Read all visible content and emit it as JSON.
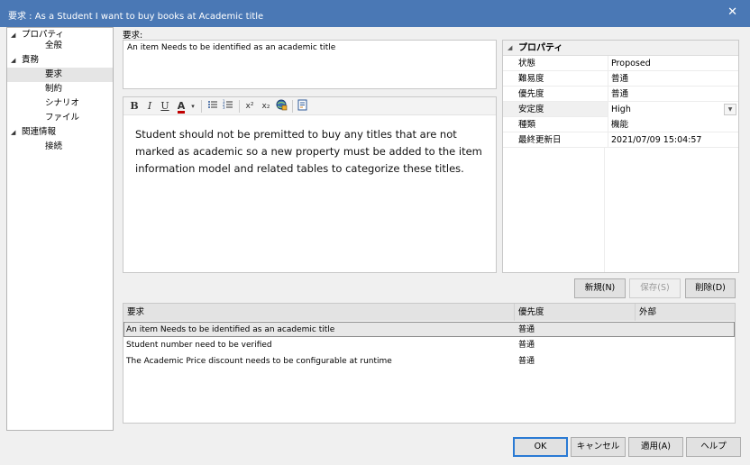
{
  "window": {
    "title": "要求 : As a Student I want to buy books at Academic title",
    "close_glyph": "✕"
  },
  "tree": {
    "items": [
      {
        "label": "プロパティ",
        "level": 0,
        "expanded": true
      },
      {
        "label": "全般",
        "level": 1
      },
      {
        "label": "責務",
        "level": 0,
        "expanded": true
      },
      {
        "label": "要求",
        "level": 1,
        "selected": true
      },
      {
        "label": "制約",
        "level": 1
      },
      {
        "label": "シナリオ",
        "level": 1
      },
      {
        "label": "ファイル",
        "level": 1
      },
      {
        "label": "関連情報",
        "level": 0,
        "expanded": true
      },
      {
        "label": "接続",
        "level": 1
      }
    ]
  },
  "requirement": {
    "section_label": "要求:",
    "summary": "An item Needs to be identified as an academic title",
    "body": "Student should not be premitted to buy any titles that are not marked as academic so a new property must be added to the item information model and related tables to categorize these titles."
  },
  "editor_toolbar": {
    "bold": "B",
    "italic": "I",
    "underline": "U",
    "font_color": "A",
    "superscript": "x²",
    "subscript": "x₂"
  },
  "properties": {
    "title": "プロパティ",
    "rows": [
      {
        "key": "状態",
        "value": "Proposed"
      },
      {
        "key": "難易度",
        "value": "普通"
      },
      {
        "key": "優先度",
        "value": "普通"
      },
      {
        "key": "安定度",
        "value": "High",
        "dropdown": true
      },
      {
        "key": "種類",
        "value": "機能"
      },
      {
        "key": "最終更新日",
        "value": "2021/07/09 15:04:57"
      }
    ]
  },
  "actions": {
    "new": "新規(N)",
    "save": "保存(S)",
    "delete": "削除(D)"
  },
  "grid": {
    "columns": [
      "要求",
      "優先度",
      "外部"
    ],
    "rows": [
      {
        "name": "An item Needs to be identified as an academic title",
        "priority": "普通",
        "external": ""
      },
      {
        "name": "Student number need to be verified",
        "priority": "普通",
        "external": ""
      },
      {
        "name": "The Academic Price discount needs to be configurable at runtime",
        "priority": "普通",
        "external": ""
      }
    ]
  },
  "footer": {
    "ok": "OK",
    "cancel": "キャンセル",
    "apply": "適用(A)",
    "help": "ヘルプ"
  },
  "colors": {
    "titlebar": "#4a78b5",
    "default_button_border": "#2a7ad4"
  }
}
